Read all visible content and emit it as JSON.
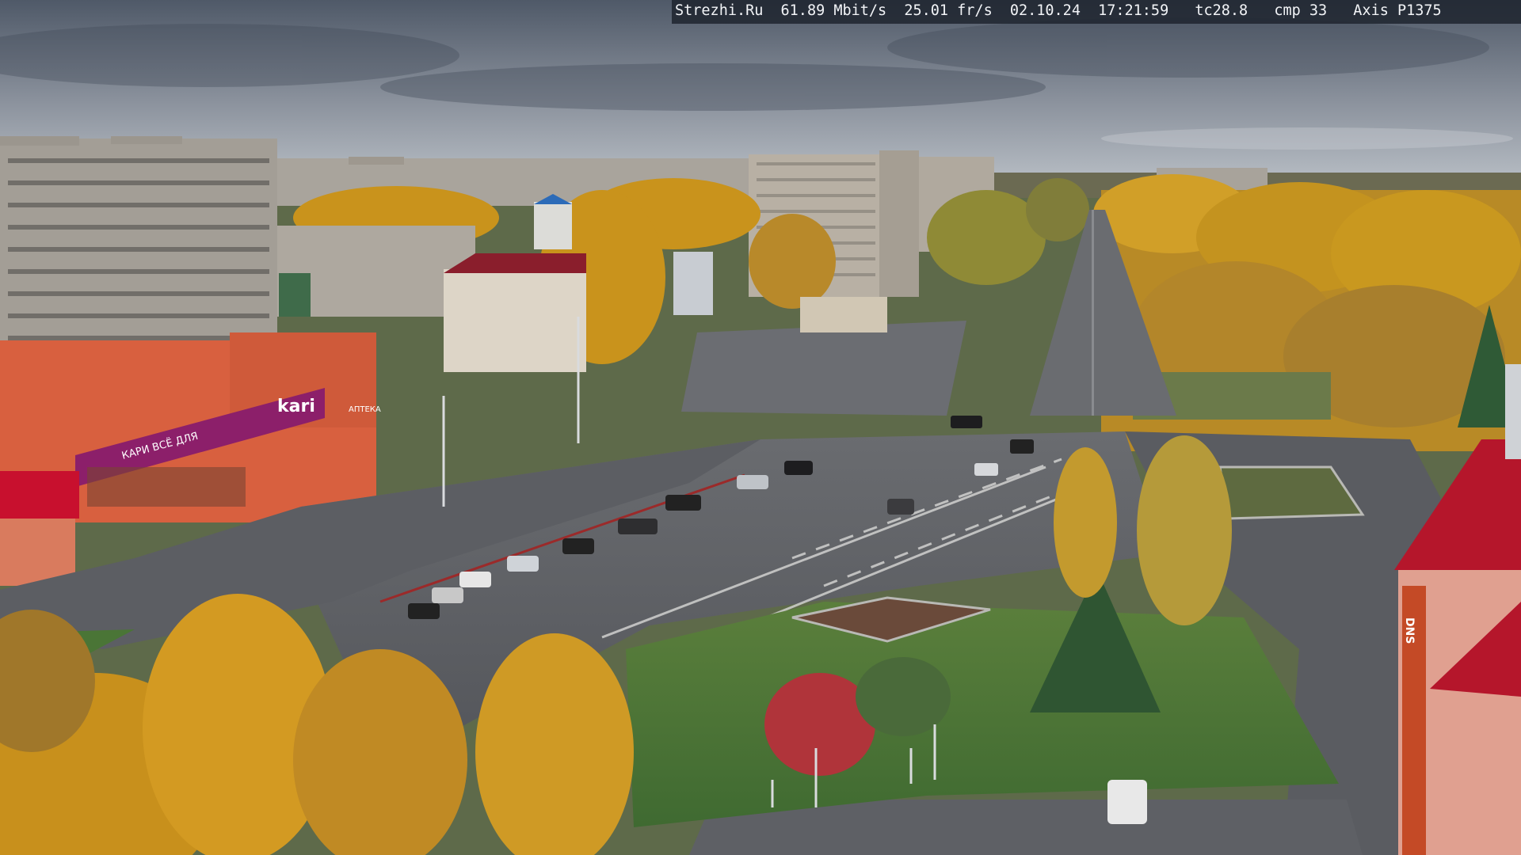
{
  "overlay": {
    "site": "Strezhi.Ru",
    "bitrate": "61.89 Mbit/s",
    "framerate": "25.01 fr/s",
    "date": "02.10.24",
    "time": "17:21:59",
    "tc": "tc28.8",
    "cmp": "cmp 33",
    "camera": "Axis P1375"
  },
  "signs": {
    "store_name": "kari",
    "store_banner": "КАРИ ВСЁ ДЛЯ",
    "shop_sign": "АПТЕКА",
    "building_sign": "DNS"
  },
  "colors": {
    "sky_top": "#4f5968",
    "sky_horizon": "#b7bdc4",
    "asphalt": "#5a5c61",
    "foliage_yellow": "#c9931c",
    "kari_magenta": "#8c1f6a",
    "roof_red": "#b5162b",
    "grass": "#4a7536"
  }
}
